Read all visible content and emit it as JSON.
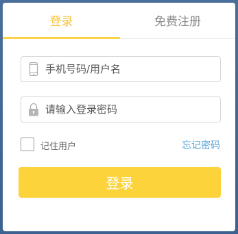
{
  "tabs": {
    "login_label": "登录",
    "register_label": "免费注册",
    "active_color": "#f6c33b",
    "inactive_color": "#8a8a8a"
  },
  "form": {
    "phone": {
      "value": "",
      "placeholder": "手机号码/用户名",
      "icon": "phone-icon"
    },
    "password": {
      "value": "",
      "placeholder": "请输入登录密码",
      "icon": "lock-icon"
    },
    "remember_label": "记住用户",
    "remember_checked": false,
    "forgot_label": "忘记密码",
    "submit_label": "登录"
  },
  "colors": {
    "accent": "#fdd33c",
    "link": "#5aa6d8"
  }
}
